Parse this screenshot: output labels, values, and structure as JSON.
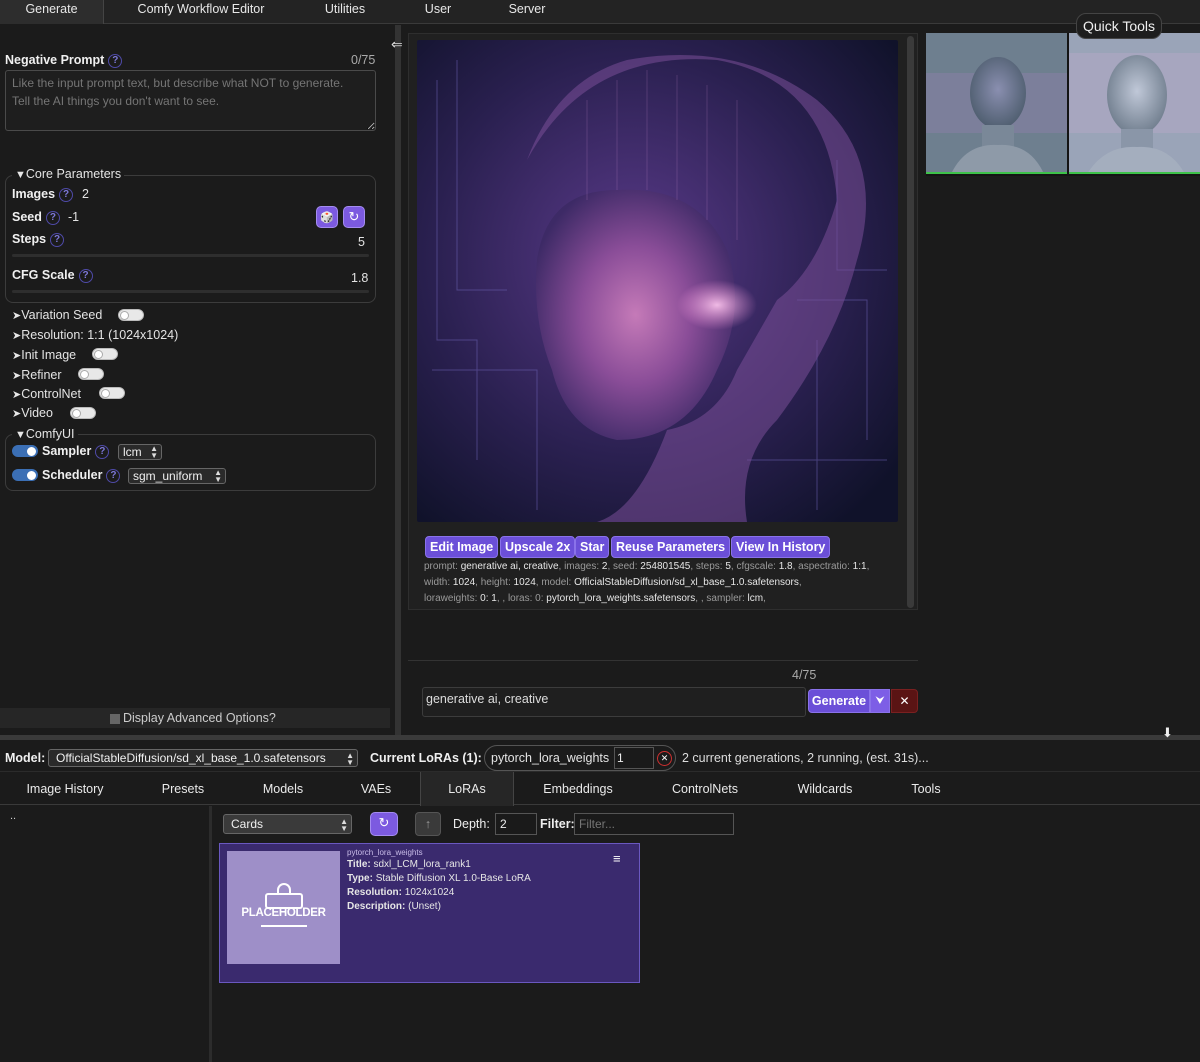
{
  "top_tabs": [
    "Generate",
    "Comfy Workflow Editor",
    "Utilities",
    "User",
    "Server"
  ],
  "negative_prompt": {
    "label": "Negative Prompt",
    "counter": "0/75",
    "placeholder": "Like the input prompt text, but describe what NOT to generate.\nTell the AI things you don't want to see."
  },
  "core_params": {
    "title": "Core Parameters",
    "images_label": "Images",
    "images_value": "2",
    "seed_label": "Seed",
    "seed_value": "-1",
    "steps_label": "Steps",
    "steps_value": "5",
    "cfg_label": "CFG Scale",
    "cfg_value": "1.8"
  },
  "sections": [
    {
      "label": "Variation Seed",
      "enabled": false
    },
    {
      "label": "Resolution: 1:1 (1024x1024)"
    },
    {
      "label": "Init Image",
      "enabled": false
    },
    {
      "label": "Refiner",
      "enabled": false
    },
    {
      "label": "ControlNet",
      "enabled": false
    },
    {
      "label": "Video",
      "enabled": false
    }
  ],
  "comfyui": {
    "title": "ComfyUI",
    "sampler_label": "Sampler",
    "sampler_value": "lcm",
    "scheduler_label": "Scheduler",
    "scheduler_value": "sgm_uniform"
  },
  "display_advanced": "Display Advanced Options?",
  "image_actions": [
    "Edit Image",
    "Upscale 2x",
    "Star",
    "Reuse Parameters",
    "View In History"
  ],
  "metadata": [
    [
      [
        "prompt: ",
        "generative ai, creative"
      ],
      [
        ", images: ",
        "2"
      ],
      [
        ", seed: ",
        "254801545"
      ],
      [
        ", steps: ",
        "5"
      ],
      [
        ", cfgscale: ",
        "1.8"
      ],
      [
        ", aspectratio: ",
        "1:1"
      ],
      [
        ",",
        ""
      ]
    ],
    [
      [
        "width: ",
        "1024"
      ],
      [
        ", height: ",
        "1024"
      ],
      [
        ", model: ",
        "OfficialStableDiffusion/sd_xl_base_1.0.safetensors"
      ],
      [
        ",",
        ""
      ]
    ],
    [
      [
        "loraweights: ",
        "0: 1"
      ],
      [
        ", , loras: 0: ",
        "pytorch_lora_weights.safetensors"
      ],
      [
        ", , sampler: ",
        "lcm"
      ],
      [
        ",",
        ""
      ]
    ]
  ],
  "prompt": {
    "counter": "4/75",
    "value": "generative ai, creative"
  },
  "generate": {
    "label": "Generate",
    "dropdown": "⮟",
    "cancel": "✕"
  },
  "quick_tools": "Quick Tools",
  "bottom_bar": {
    "model_label": "Model:",
    "model_value": "OfficialStableDiffusion/sd_xl_base_1.0.safetensors",
    "loras_label": "Current LoRAs (1):",
    "lora_name": "pytorch_lora_weights",
    "lora_weight": "1",
    "status": "2 current generations, 2 running, (est. 31s)..."
  },
  "bottom_tabs": [
    "Image History",
    "Presets",
    "Models",
    "VAEs",
    "LoRAs",
    "Embeddings",
    "ControlNets",
    "Wildcards",
    "Tools"
  ],
  "active_bottom_tab": "LoRAs",
  "tree_root": "..",
  "browser": {
    "view_mode": "Cards",
    "depth_label": "Depth:",
    "depth_value": "2",
    "filter_label": "Filter:",
    "filter_placeholder": "Filter..."
  },
  "lora_card": {
    "filename": "pytorch_lora_weights",
    "placeholder_text": "PLACEHOLDER",
    "title_label": "Title:",
    "title_value": "sdxl_LCM_lora_rank1",
    "type_label": "Type:",
    "type_value": "Stable Diffusion XL 1.0-Base LoRA",
    "res_label": "Resolution:",
    "res_value": "1024x1024",
    "desc_label": "Description:",
    "desc_value": "(Unset)"
  },
  "icons": {
    "collapse": "⇐",
    "download": "⬇",
    "menu": "≡",
    "dice": "🎲",
    "refresh": "↻"
  },
  "colors": {
    "accent": "#6b4fd8",
    "card_bg": "#3a2a6e",
    "ok": "#3ec24a"
  }
}
